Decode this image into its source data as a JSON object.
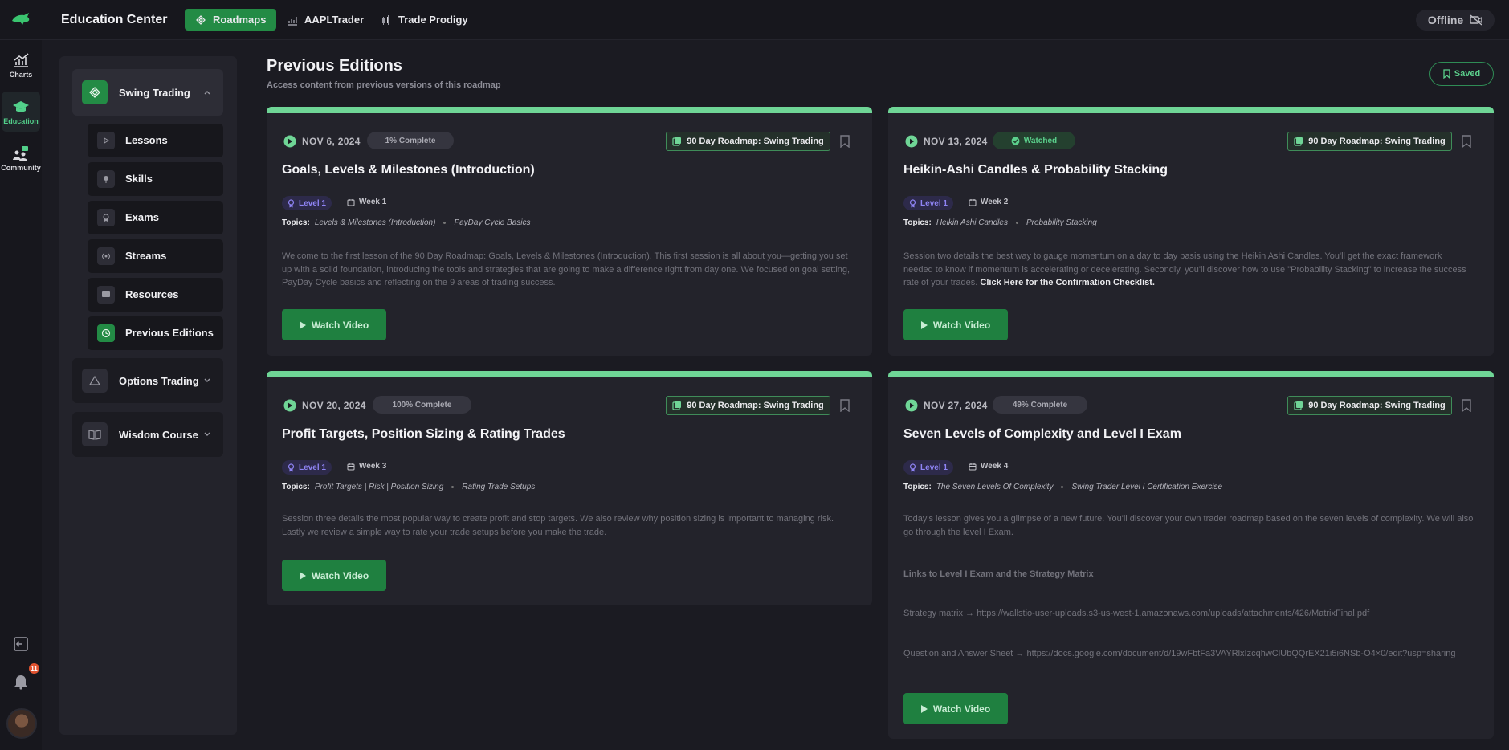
{
  "topbar": {
    "title": "Education Center",
    "tabs": [
      {
        "label": "Roadmaps",
        "active": true
      },
      {
        "label": "AAPLTrader",
        "active": false
      },
      {
        "label": "Trade Prodigy",
        "active": false
      }
    ],
    "status": "Offline"
  },
  "rail": {
    "items": [
      {
        "label": "Charts",
        "icon": "chart-icon"
      },
      {
        "label": "Education",
        "icon": "graduation-cap-icon",
        "active": true
      },
      {
        "label": "Community",
        "icon": "community-icon"
      }
    ],
    "notification_count": "11"
  },
  "sidebar": {
    "courses": [
      {
        "label": "Swing Trading",
        "expanded": true
      },
      {
        "label": "Options Trading",
        "expanded": false
      },
      {
        "label": "Wisdom Course",
        "expanded": false
      }
    ],
    "subitems": [
      {
        "label": "Lessons",
        "icon": "play-icon"
      },
      {
        "label": "Skills",
        "icon": "pin-icon"
      },
      {
        "label": "Exams",
        "icon": "medal-icon"
      },
      {
        "label": "Streams",
        "icon": "broadcast-icon"
      },
      {
        "label": "Resources",
        "icon": "monitor-icon"
      },
      {
        "label": "Previous Editions",
        "icon": "history-icon",
        "active": true
      }
    ]
  },
  "main": {
    "title": "Previous Editions",
    "subtitle": "Access content from previous versions of this roadmap",
    "saved_label": "Saved"
  },
  "colors": {
    "accent": "#238b45",
    "card_bar": "#6fd596",
    "level": "#8f84f5"
  },
  "cards": [
    {
      "date": "NOV 6, 2024",
      "status": "1% Complete",
      "tag": "90 Day Roadmap: Swing Trading",
      "title": "Goals, Levels & Milestones (Introduction)",
      "level": "Level 1",
      "week": "Week 1",
      "topics_label": "Topics:",
      "topics": [
        "Levels & Milestones (Introduction)",
        "PayDay Cycle Basics"
      ],
      "desc": "Welcome to the first lesson of the 90 Day Roadmap: Goals, Levels & Milestones (Introduction). This first session is all about you—getting you set up with a solid foundation, introducing the tools and strategies that are going to make a difference right from day one. We focused on goal setting, PayDay Cycle basics and reflecting on the 9 areas of trading success.",
      "button": "Watch Video"
    },
    {
      "date": "NOV 13, 2024",
      "status": "Watched",
      "tag": "90 Day Roadmap: Swing Trading",
      "title": "Heikin-Ashi Candles & Probability Stacking",
      "level": "Level 1",
      "week": "Week 2",
      "topics_label": "Topics:",
      "topics": [
        "Heikin Ashi Candles",
        "Probability Stacking"
      ],
      "desc": "Session two details the best way to gauge momentum on a day to day basis using the Heikin Ashi Candles. You'll get the exact framework needed to know if momentum is accelerating or decelerating. Secondly, you'll discover how to use \"Probability Stacking\" to increase the success rate of your trades.",
      "desc_link": "Click Here for the Confirmation Checklist.",
      "button": "Watch Video"
    },
    {
      "date": "NOV 20, 2024",
      "status": "100% Complete",
      "tag": "90 Day Roadmap: Swing Trading",
      "title": "Profit Targets, Position Sizing & Rating Trades",
      "level": "Level 1",
      "week": "Week 3",
      "topics_label": "Topics:",
      "topics": [
        "Profit Targets | Risk | Position Sizing",
        "Rating Trade Setups"
      ],
      "desc": "Session three details the most popular way to create profit and stop targets. We also review why position sizing is important to managing risk. Lastly we review a simple way to rate your trade setups before you make the trade.",
      "button": "Watch Video"
    },
    {
      "date": "NOV 27, 2024",
      "status": "49% Complete",
      "tag": "90 Day Roadmap: Swing Trading",
      "title": "Seven Levels of Complexity and Level I Exam",
      "level": "Level 1",
      "week": "Week 4",
      "topics_label": "Topics:",
      "topics": [
        "The Seven Levels Of Complexity",
        "Swing Trader Level I Certification Exercise"
      ],
      "desc": "Today's lesson gives you a glimpse of a new future. You'll discover your own trader roadmap based on the seven levels of complexity. We will also go through the level I Exam.",
      "links_heading": "Links to Level I Exam and the Strategy Matrix",
      "link1": "Strategy matrix → https://wallstio-user-uploads.s3-us-west-1.amazonaws.com/uploads/attachments/426/MatrixFinal.pdf",
      "link2": "Question and Answer Sheet → https://docs.google.com/document/d/19wFbtFa3VAYRlxIzcqhwClUbQQrEX21i5i6NSb-O4×0/edit?usp=sharing",
      "button": "Watch Video"
    }
  ]
}
